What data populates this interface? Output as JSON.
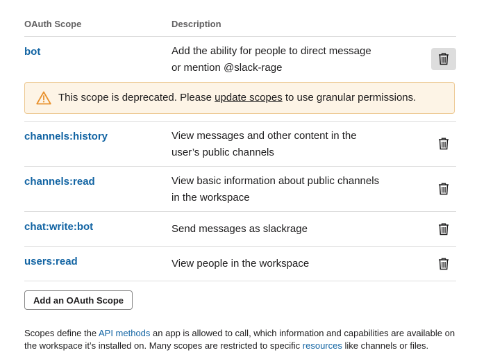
{
  "table": {
    "col_scope": "OAuth Scope",
    "col_description": "Description"
  },
  "scopes": [
    {
      "name": "bot",
      "desc_line1": "Add the ability for people to direct message",
      "desc_line2": "or mention @slack-rage"
    },
    {
      "name": "channels:history",
      "desc_line1": "View messages and other content in the",
      "desc_line2": "user’s public channels"
    },
    {
      "name": "channels:read",
      "desc_line1": "View basic information about public channels",
      "desc_line2": "in the workspace"
    },
    {
      "name": "chat:write:bot",
      "desc_line1": "Send messages as slackrage"
    },
    {
      "name": "users:read",
      "desc_line1": "View people in the workspace"
    }
  ],
  "warning": {
    "text_before": "This scope is deprecated. Please ",
    "link": "update scopes",
    "text_after": " to use granular permissions."
  },
  "add_button_label": "Add an OAuth Scope",
  "footer": {
    "t1": "Scopes define the ",
    "link1": "API methods",
    "t2": " an app is allowed to call, which information and capabilities are available on the workspace it’s installed on. Many scopes are restricted to specific ",
    "link2": "resources",
    "t3": " like channels or files."
  },
  "colors": {
    "link": "#1264a3",
    "warning_bg": "#fdf4e6",
    "warning_border": "#ecc78f",
    "warning_icon": "#e8912d"
  },
  "icons": {
    "delete": "trash-icon",
    "warning": "warning-triangle-icon"
  }
}
